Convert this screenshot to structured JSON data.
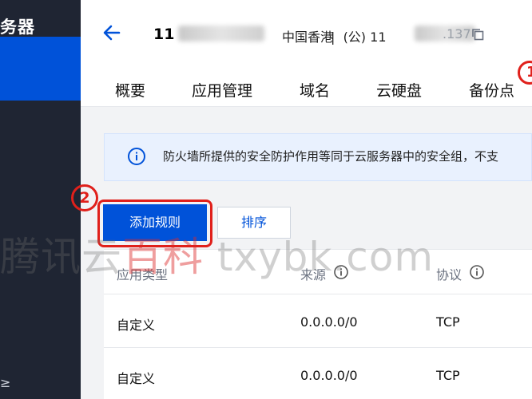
{
  "sidebar": {
    "title": "务器",
    "bottom_text": "≥"
  },
  "header": {
    "server_id": "11",
    "region": "中国香港",
    "ip_prefix": "|  (公) 11",
    "ip_suffix": ".137"
  },
  "tabs": [
    {
      "label": "概要"
    },
    {
      "label": "应用管理"
    },
    {
      "label": "域名"
    },
    {
      "label": "云硬盘"
    },
    {
      "label": "备份点"
    }
  ],
  "annotations": {
    "badge1": "1",
    "badge2": "2"
  },
  "notice": {
    "text": "防火墙所提供的安全防护作用等同于云服务器中的安全组，不支"
  },
  "toolbar": {
    "add_rule": "添加规则",
    "sort": "排序"
  },
  "table": {
    "columns": [
      "应用类型",
      "来源",
      "协议"
    ],
    "rows": [
      {
        "type": "自定义",
        "source": "0.0.0.0/0",
        "protocol": "TCP"
      },
      {
        "type": "自定义",
        "source": "0.0.0.0/0",
        "protocol": "TCP"
      }
    ]
  },
  "watermark": {
    "text_gray1": "腾讯云",
    "text_red": "百科",
    "text_gray2": " txybk.com"
  },
  "colors": {
    "accent": "#0052d9",
    "annotation": "#e0201b",
    "sidebar": "#1f2533"
  }
}
